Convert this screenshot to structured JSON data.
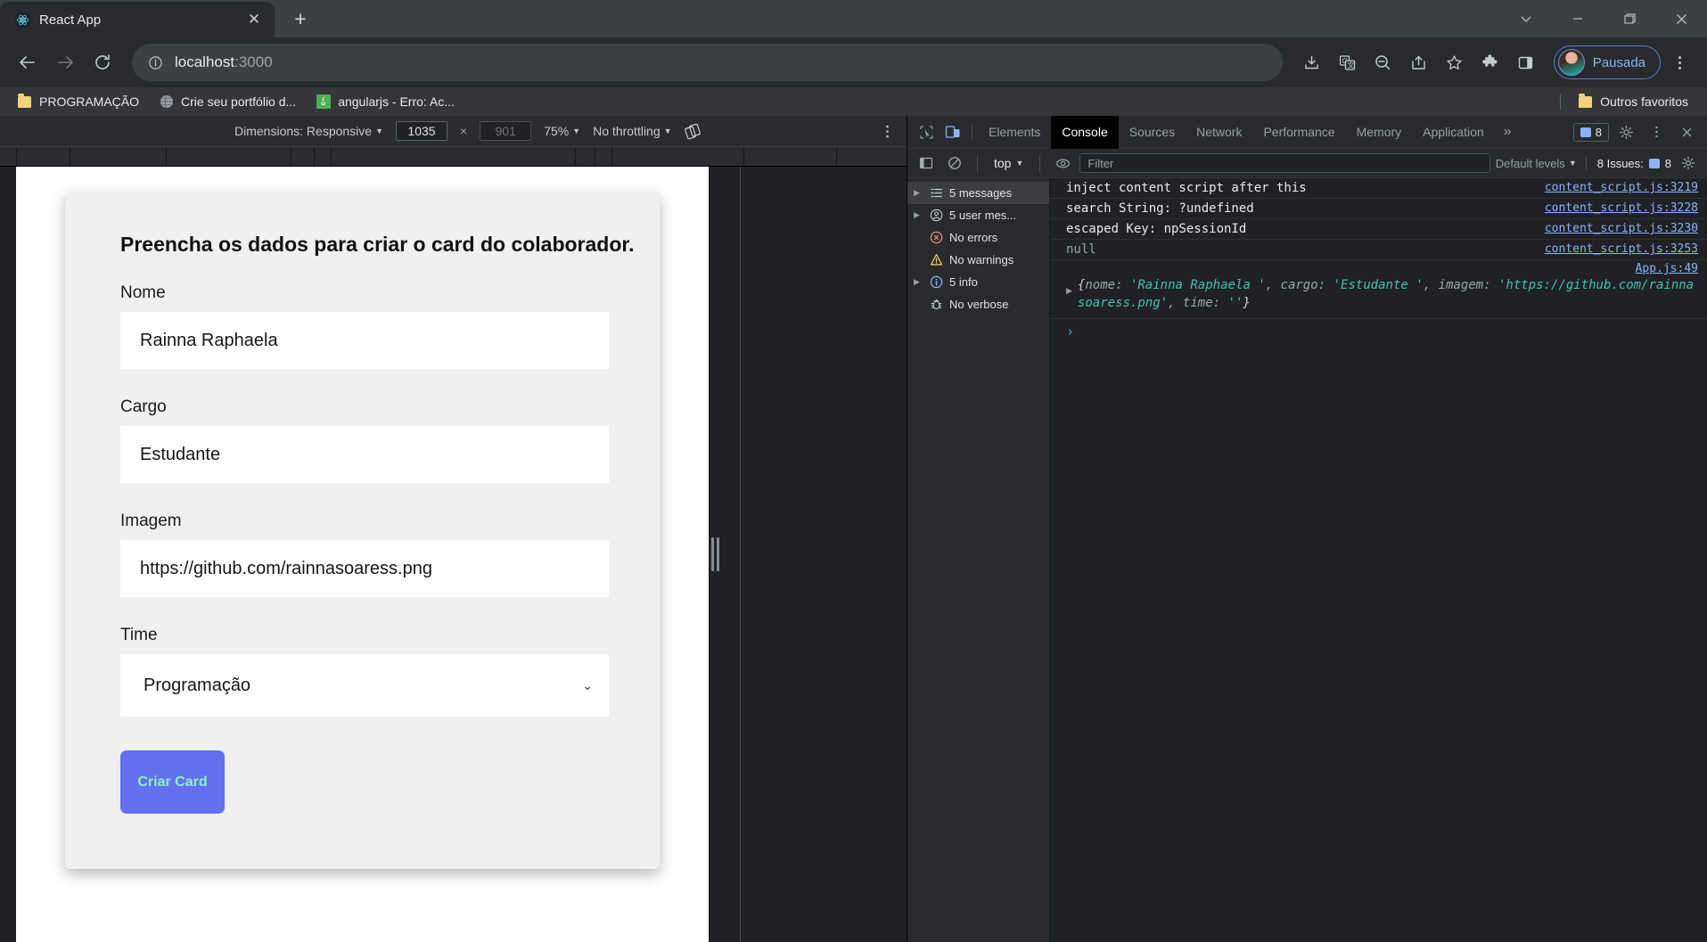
{
  "browser": {
    "tab": {
      "title": "React App",
      "favicon": "react-icon",
      "close": "✕"
    },
    "new_tab": "+",
    "window_controls": {
      "chevron": "chevron-down-icon",
      "minimize": "minimize-icon",
      "maximize": "maximize-icon",
      "close": "close-icon"
    },
    "nav": {
      "back": "back-arrow-icon",
      "forward": "forward-arrow-icon",
      "reload": "reload-icon"
    },
    "omnibox": {
      "info_icon": "site-info-icon",
      "host": "localhost",
      "path": ":3000"
    },
    "actions": [
      "install-icon",
      "translate-icon",
      "zoom-out-icon",
      "share-icon",
      "bookmark-star-icon",
      "extensions-puzzle-icon",
      "side-panel-icon"
    ],
    "profile": {
      "label": "Pausada",
      "avatar": "user-avatar"
    },
    "menu": "three-dot-menu-icon",
    "bookmarks": [
      {
        "label": "PROGRAMAÇÃO",
        "icon": "folder-icon"
      },
      {
        "label": "Crie seu portfólio d...",
        "icon": "globe-icon"
      },
      {
        "label": "angularjs - Erro: Ac...",
        "icon": "java-icon"
      }
    ],
    "other_bookmarks": {
      "label": "Outros favoritos",
      "icon": "folder-icon"
    }
  },
  "device_toolbar": {
    "dimensions_label": "Dimensions: Responsive",
    "width_value": "1035",
    "times": "×",
    "height_placeholder": "901",
    "zoom": "75%",
    "throttling": "No throttling",
    "rotate_icon": "rotate-icon",
    "more_icon": "three-dot-menu-icon"
  },
  "page": {
    "title": "Preencha os dados para criar o card do colaborador.",
    "fields": [
      {
        "label": "Nome",
        "value": "Rainna Raphaela",
        "type": "text"
      },
      {
        "label": "Cargo",
        "value": "Estudante",
        "type": "text"
      },
      {
        "label": "Imagem",
        "value": "https://github.com/rainnasoaress.png",
        "type": "text"
      },
      {
        "label": "Time",
        "value": "Programação",
        "type": "select"
      }
    ],
    "submit_label": "Criar Card",
    "submit_bg": "#6370f0",
    "submit_color": "#8df2c4"
  },
  "devtools": {
    "left_icons": [
      "inspect-element-icon",
      "device-toolbar-icon"
    ],
    "tabs": [
      "Elements",
      "Console",
      "Sources",
      "Network",
      "Performance",
      "Memory",
      "Application"
    ],
    "selected_tab": "Console",
    "overflow": "»",
    "issues_badge": "8",
    "settings_icon": "gear-icon",
    "more_icon": "three-dot-menu-icon",
    "close_icon": "close-icon",
    "filterbar": {
      "sidebar_toggle_icon": "console-sidebar-icon",
      "clear_icon": "clear-console-icon",
      "context": "top",
      "eye_icon": "live-expression-icon",
      "filter_placeholder": "Filter",
      "levels": "Default levels",
      "issues_text": "8 Issues:",
      "issues_count": "8",
      "settings_icon": "gear-icon"
    },
    "sidebar": [
      {
        "label": "5 messages",
        "icon": "list-icon",
        "arrow": true,
        "selected": true
      },
      {
        "label": "5 user mes...",
        "icon": "user-icon",
        "arrow": true,
        "selected": false
      },
      {
        "label": "No errors",
        "icon": "error-icon",
        "arrow": false,
        "selected": false
      },
      {
        "label": "No warnings",
        "icon": "warning-icon",
        "arrow": false,
        "selected": false
      },
      {
        "label": "5 info",
        "icon": "info-icon",
        "arrow": true,
        "selected": false
      },
      {
        "label": "No verbose",
        "icon": "bug-icon",
        "arrow": false,
        "selected": false
      }
    ],
    "logs": [
      {
        "text": "inject content script after this",
        "source": "content_script.js:3219",
        "muted": false
      },
      {
        "text": "search String: ?undefined",
        "source": "content_script.js:3228",
        "muted": false
      },
      {
        "text": "escaped Key: npSessionId",
        "source": "content_script.js:3230",
        "muted": false
      },
      {
        "text": "null",
        "source": "content_script.js:3253",
        "muted": true
      }
    ],
    "object_log": {
      "source": "App.js:49",
      "prefix": "{",
      "entries": [
        {
          "key": "nome: ",
          "value": "'Rainna Raphaela '"
        },
        {
          "key": ", cargo: ",
          "value": "'Estudante '"
        },
        {
          "key": ", imagem: ",
          "value": "'https://github.com/rainnasoaress.png'"
        },
        {
          "key": ", time: ",
          "value": "''"
        }
      ],
      "suffix": "}"
    },
    "prompt": "›"
  }
}
